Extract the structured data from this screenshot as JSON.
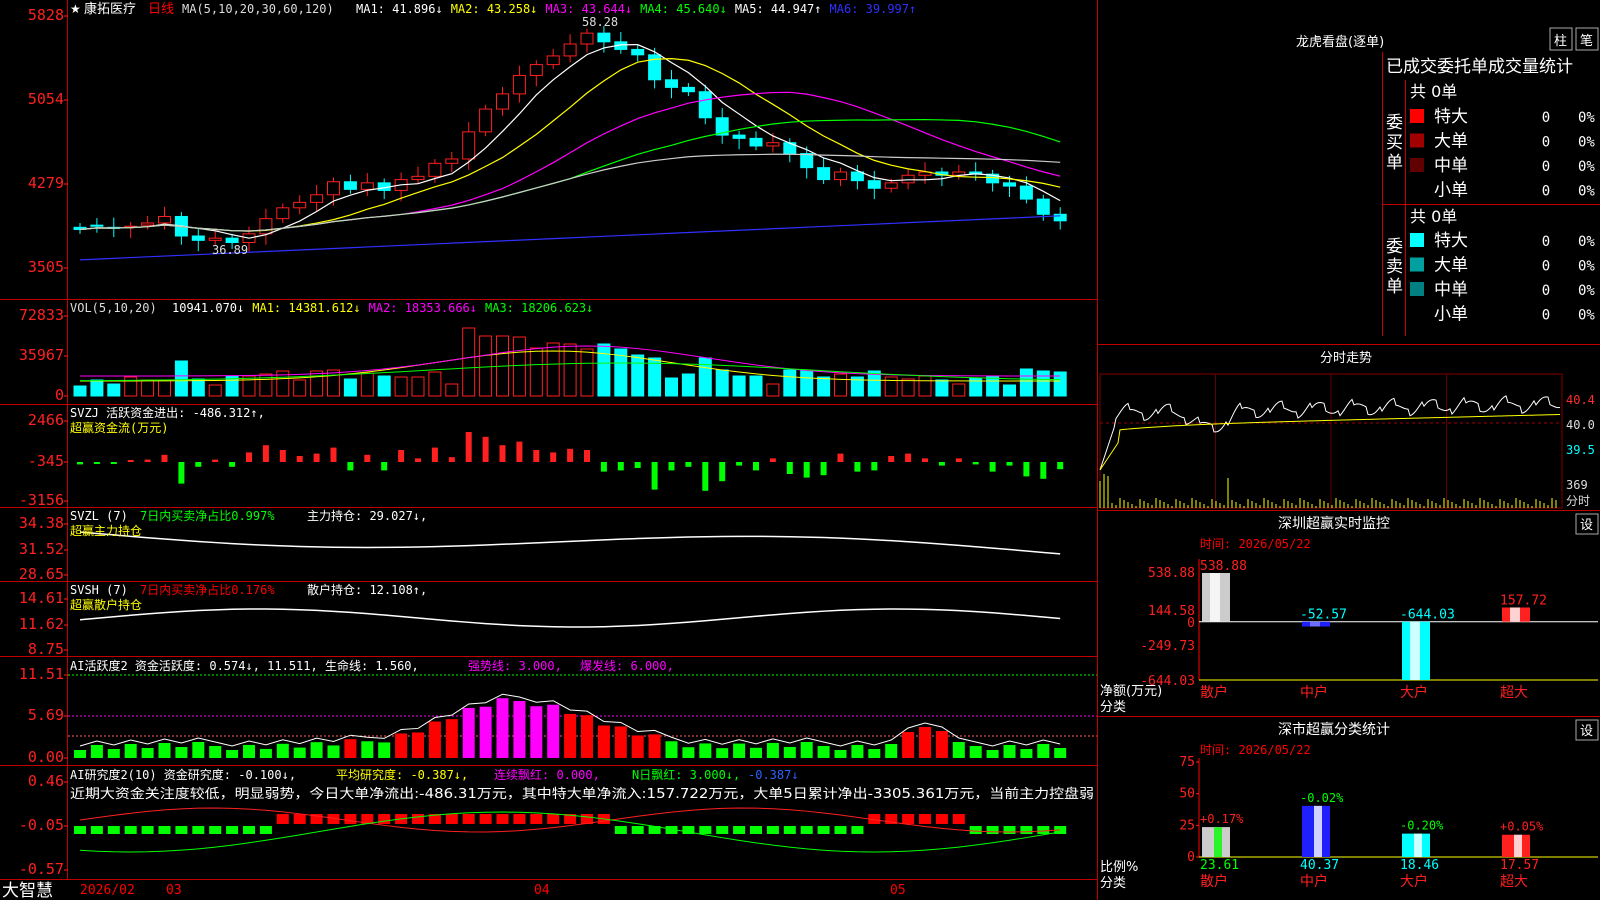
{
  "header": {
    "stock_name": "康拓医疗",
    "period": "日线",
    "ma_label": "MA(5,10,20,30,60,120)",
    "ma_values": [
      {
        "label": "MA1: 41.896↓",
        "color": "#ffffff"
      },
      {
        "label": "MA2: 43.258↓",
        "color": "#ffff00"
      },
      {
        "label": "MA3: 43.644↓",
        "color": "#ff00ff"
      },
      {
        "label": "MA4: 45.640↓",
        "color": "#00ff00"
      },
      {
        "label": "MA5: 44.947↑",
        "color": "#ffffff"
      },
      {
        "label": "MA6: 39.997↑",
        "color": "#3030ff"
      }
    ],
    "high_mark": "58.28",
    "low_mark": "36.89"
  },
  "price_panel": {
    "ticks": [
      "5828",
      "5054",
      "4279",
      "3505"
    ]
  },
  "vol_panel": {
    "label": "VOL(5,10,20)",
    "values": [
      {
        "label": "10941.070↓",
        "color": "#ffffff"
      },
      {
        "label": "MA1: 14381.612↓",
        "color": "#ffff00"
      },
      {
        "label": "MA2: 18353.666↓",
        "color": "#ff00ff"
      },
      {
        "label": "MA3: 18206.623↓",
        "color": "#00ff00"
      }
    ],
    "ticks": [
      "72833",
      "35967",
      "0"
    ]
  },
  "svzj_panel": {
    "label": "SVZJ  活跃资金进出: -486.312↑,",
    "sub": "超赢资金流(万元)",
    "ticks": [
      "2466",
      "-345",
      "-3156"
    ]
  },
  "svzl_panel": {
    "label": "SVZL (7)",
    "net": "7日内买卖净占比0.997%",
    "hold": "主力持仓: 29.027↓,",
    "sub": "超赢主力持仓",
    "ticks": [
      "34.38",
      "31.52",
      "28.65"
    ]
  },
  "svsh_panel": {
    "label": "SVSH (7)",
    "net": "7日内买卖净占比0.176%",
    "hold": "散户持仓: 12.108↑,",
    "sub": "超赢散户持仓",
    "ticks": [
      "14.61",
      "11.62",
      "8.75"
    ]
  },
  "ai_panel": {
    "label": "AI活跃度2 资金活跃度: 0.574↓, 11.511, 生命线: 1.560,",
    "strong": "强势线: 3.000,",
    "burst": "爆发线: 6.000,",
    "ticks": [
      "11.51",
      "5.69",
      "0.00"
    ]
  },
  "ai2_panel": {
    "label": "AI研究度2(10) 资金研究度: -0.100↓,",
    "avg": "平均研究度: -0.387↓,",
    "red": "连续飘红: 0.000,",
    "n": "N日飘红: 3.000↓,",
    "last": "-0.387↓",
    "comment": "近期大资金关注度较低，明显弱势，今日大单净流出:-486.31万元，其中特大单净流入:157.722万元，大单5日累计净出-3305.361万元，当前主力控盘弱",
    "ticks": [
      "0.46",
      "-0.05",
      "-0.57"
    ]
  },
  "bottom": {
    "logo": "大智慧",
    "dates": [
      "2026/02",
      "03",
      "04",
      "05"
    ]
  },
  "dragon": {
    "title": "龙虎看盘(逐单)",
    "btn1": "柱",
    "btn2": "笔",
    "subtitle": "已成交委托单成交量统计",
    "buy_title": "委买单",
    "sell_title": "委卖单",
    "buy_total": "共 0单",
    "sell_total": "共 0单",
    "buy_rows": [
      {
        "name": "特大",
        "val": "0",
        "pct": "0%",
        "color": "#ff0000"
      },
      {
        "name": "大单",
        "val": "0",
        "pct": "0%",
        "color": "#a00000"
      },
      {
        "name": "中单",
        "val": "0",
        "pct": "0%",
        "color": "#600000"
      },
      {
        "name": "小单",
        "val": "0",
        "pct": "0%",
        "color": ""
      }
    ],
    "sell_rows": [
      {
        "name": "特大",
        "val": "0",
        "pct": "0%",
        "color": "#00ffff"
      },
      {
        "name": "大单",
        "val": "0",
        "pct": "0%",
        "color": "#00a0a0"
      },
      {
        "name": "中单",
        "val": "0",
        "pct": "0%",
        "color": "#008080"
      },
      {
        "name": "小单",
        "val": "0",
        "pct": "0%",
        "color": ""
      }
    ]
  },
  "intraday": {
    "title": "分时走势",
    "ticks": [
      "40.4",
      "40.0",
      "39.5"
    ],
    "vol": "369",
    "vol_label": "分时"
  },
  "sz_monitor": {
    "title": "深圳超赢实时监控",
    "btn": "设",
    "time": "时间: 2026/05/22",
    "ticks": [
      "538.88",
      "144.58",
      "0",
      "-249.73",
      "-644.03"
    ],
    "ylabel1": "净额(万元)",
    "ylabel2": "分类",
    "categories": [
      "散户",
      "中户",
      "大户",
      "超大"
    ],
    "values": [
      538.88,
      -52.57,
      -644.03,
      157.72
    ],
    "value_labels": [
      "538.88",
      "-52.57",
      "-644.03",
      "157.72"
    ]
  },
  "sz_class": {
    "title": "深市超赢分类统计",
    "btn": "设",
    "time": "时间: 2026/05/22",
    "ticks": [
      "75",
      "50",
      "25",
      "0"
    ],
    "ylabel1": "比例%",
    "ylabel2": "分类",
    "categories": [
      "散户",
      "中户",
      "大户",
      "超大"
    ],
    "values": [
      23.61,
      40.37,
      18.46,
      17.57
    ],
    "value_labels": [
      "23.61",
      "40.37",
      "18.46",
      "17.57"
    ],
    "changes": [
      "+0.17%",
      "-0.02%",
      "-0.20%",
      "+0.05%"
    ]
  },
  "chart_data": [
    {
      "type": "candlestick",
      "title": "康拓医疗 日线",
      "ylim": [
        35.05,
        58.28
      ],
      "close": [
        38.6,
        38.9,
        38.7,
        38.9,
        39.2,
        39.8,
        38.0,
        37.6,
        37.8,
        37.4,
        38.2,
        39.6,
        40.6,
        41.1,
        41.8,
        43.0,
        42.3,
        42.9,
        42.2,
        43.2,
        43.5,
        44.7,
        45.1,
        47.6,
        49.7,
        51.1,
        52.8,
        53.8,
        54.6,
        55.7,
        56.7,
        55.9,
        55.2,
        54.7,
        52.4,
        51.7,
        51.3,
        48.9,
        47.3,
        47.0,
        46.3,
        46.6,
        45.6,
        44.3,
        43.2,
        43.9,
        43.1,
        42.4,
        42.9,
        43.6,
        43.9,
        43.6,
        43.9,
        43.7,
        42.9,
        42.6,
        41.4,
        40.0,
        39.4
      ],
      "open": [
        38.8,
        39.0,
        38.8,
        38.8,
        39.0,
        39.2,
        39.8,
        38.0,
        37.6,
        37.8,
        37.4,
        38.2,
        39.6,
        40.6,
        41.1,
        41.8,
        43.0,
        42.3,
        42.9,
        42.2,
        43.2,
        43.5,
        44.7,
        45.1,
        47.6,
        49.7,
        51.1,
        52.8,
        53.8,
        54.6,
        55.7,
        56.7,
        55.9,
        55.2,
        54.7,
        52.4,
        51.7,
        51.3,
        48.9,
        47.3,
        47.0,
        46.3,
        46.6,
        45.6,
        44.3,
        43.2,
        43.9,
        43.1,
        42.4,
        42.9,
        43.6,
        43.9,
        43.6,
        43.9,
        43.7,
        42.9,
        42.6,
        41.4,
        40.0
      ],
      "ma_series": [
        "MA1",
        "MA2",
        "MA3",
        "MA4",
        "MA5",
        "MA6"
      ]
    },
    {
      "type": "bar",
      "title": "VOL(5,10,20)",
      "ylim": [
        0,
        72833
      ]
    },
    {
      "type": "bar",
      "title": "深圳超赢实时监控",
      "categories": [
        "散户",
        "中户",
        "大户",
        "超大"
      ],
      "values": [
        538.88,
        -52.57,
        -644.03,
        157.72
      ],
      "ylim": [
        -644.03,
        538.88
      ]
    },
    {
      "type": "bar",
      "title": "深市超赢分类统计",
      "categories": [
        "散户",
        "中户",
        "大户",
        "超大"
      ],
      "values": [
        23.61,
        40.37,
        18.46,
        17.57
      ],
      "ylim": [
        0,
        75
      ]
    }
  ]
}
